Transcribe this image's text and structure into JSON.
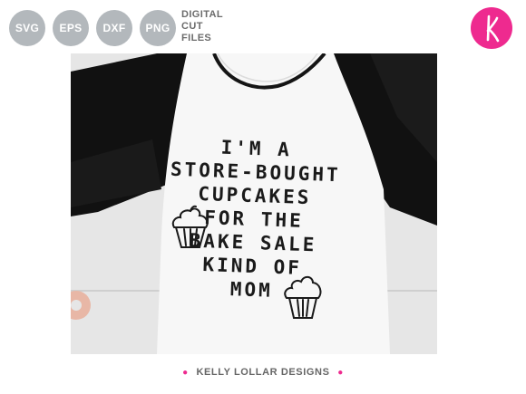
{
  "badges": [
    "SVG",
    "EPS",
    "DXF",
    "PNG"
  ],
  "digital_cut_files": [
    "DIGITAL",
    "CUT",
    "FILES"
  ],
  "shirt_lines": [
    "I'M A",
    "STORE-BOUGHT",
    "CUPCAKES",
    "FOR THE",
    "BAKE SALE",
    "KIND OF",
    "MOM"
  ],
  "footer": "KELLY LOLLAR DESIGNS",
  "colors": {
    "accent": "#ee2a8f",
    "badge": "#b3b8bc",
    "sleeve": "#0f0f0f"
  }
}
